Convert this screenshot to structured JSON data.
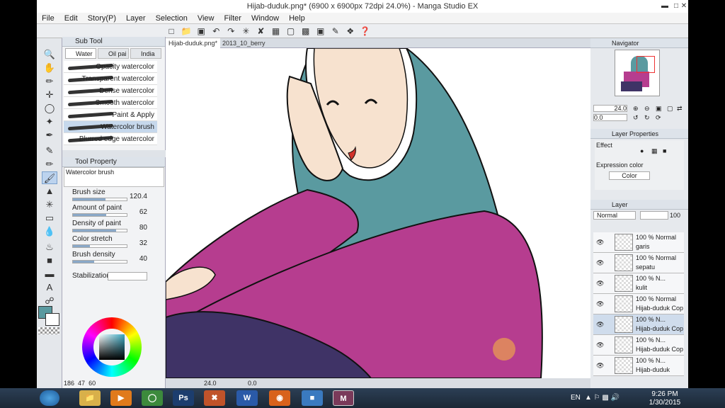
{
  "window": {
    "title": "Hijab-duduk.png* (6900 x 6900px 72dpi 24.0%) - Manga Studio EX"
  },
  "menu": [
    "File",
    "Edit",
    "Story(P)",
    "Layer",
    "Selection",
    "View",
    "Filter",
    "Window",
    "Help"
  ],
  "subtool": {
    "title": "Sub Tool",
    "tabs": [
      "Water",
      "Oil pai",
      "India in"
    ],
    "brushes": [
      "Opacity watercolor",
      "Transparent watercolor",
      "Dense watercolor",
      "Smooth watercolor",
      "Paint & Apply",
      "Watercolor brush",
      "Blurred edge watercolor"
    ],
    "selected": "Watercolor brush"
  },
  "toolprop": {
    "title": "Tool Property",
    "preview_label": "Watercolor brush",
    "props": [
      {
        "label": "Brush size",
        "value": "120.4",
        "level": 0.6
      },
      {
        "label": "Amount of paint",
        "value": "62",
        "level": 0.62
      },
      {
        "label": "Density of paint",
        "value": "80",
        "level": 0.8
      },
      {
        "label": "Color stretch",
        "value": "32",
        "level": 0.32
      },
      {
        "label": "Brush density",
        "value": "40",
        "level": 0.4
      }
    ],
    "stabilization_label": "Stabilization"
  },
  "color": {
    "readout": "186",
    "readout2": "47",
    "readout3": "60",
    "main_color": "#5a9aa0"
  },
  "tabs": [
    "Hijab-duduk.png*",
    "2013_10_berry"
  ],
  "canvas_status": {
    "zoom": "24.0",
    "rotation": "0.0"
  },
  "navigator": {
    "title": "Navigator",
    "zoom": "24.0",
    "rotation": "0.0"
  },
  "layer_properties": {
    "title": "Layer Properties",
    "effect_label": "Effect",
    "expression_label": "Expression color",
    "expression_value": "Color"
  },
  "layers_panel": {
    "title": "Layer",
    "blend": "Normal",
    "opacity": "100",
    "layers": [
      {
        "pct": "100 %",
        "mode": "Normal",
        "name": "garis"
      },
      {
        "pct": "100 %",
        "mode": "Normal",
        "name": "sepatu"
      },
      {
        "pct": "100 %",
        "mode": "N...",
        "name": "kulit"
      },
      {
        "pct": "100 %",
        "mode": "Normal",
        "name": "Hijab-duduk Cop"
      },
      {
        "pct": "100 %",
        "mode": "N...",
        "name": "Hijab-duduk Cop"
      },
      {
        "pct": "100 %",
        "mode": "N...",
        "name": "Hijab-duduk Cop"
      },
      {
        "pct": "100 %",
        "mode": "N...",
        "name": "Hijab-duduk"
      }
    ]
  },
  "taskbar": {
    "lang": "EN",
    "time": "9:26 PM",
    "date": "1/30/2015"
  }
}
